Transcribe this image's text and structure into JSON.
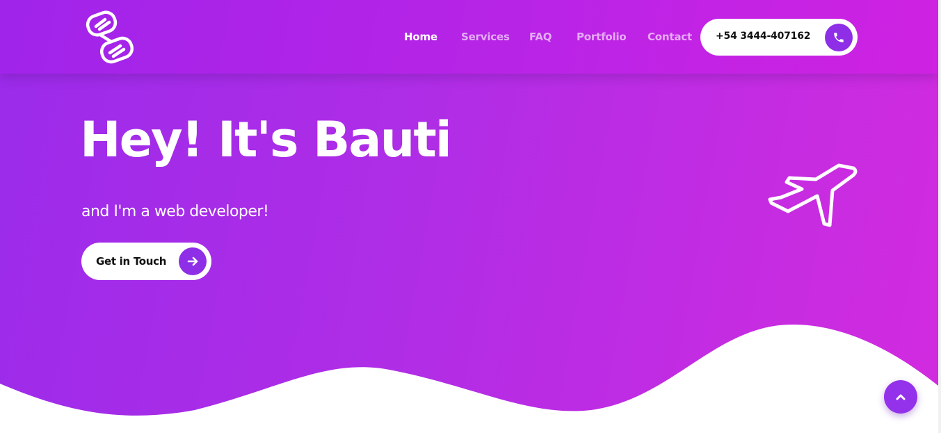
{
  "header": {
    "logo_icon": "dna-logo-icon",
    "nav": [
      {
        "label": "Home",
        "active": true
      },
      {
        "label": "Services",
        "active": false
      },
      {
        "label": "FAQ",
        "active": false
      },
      {
        "label": "Portfolio",
        "active": false
      },
      {
        "label": "Contact",
        "active": false
      }
    ],
    "phone": {
      "number": "+54 3444-407162",
      "icon": "phone-icon"
    }
  },
  "hero": {
    "title": "Hey! It's Bauti",
    "subtitle": "and I'm a web developer!",
    "cta": {
      "label": "Get in Touch",
      "icon": "arrow-right-icon"
    },
    "decoration_icon": "airplane-icon"
  },
  "back_to_top": {
    "icon": "chevron-up-icon"
  },
  "colors": {
    "gradient_start": "#9b2bea",
    "gradient_end": "#d22bdf",
    "accent": "#8e2ee6",
    "text_light": "#ffffff",
    "text_dark": "#111111"
  }
}
